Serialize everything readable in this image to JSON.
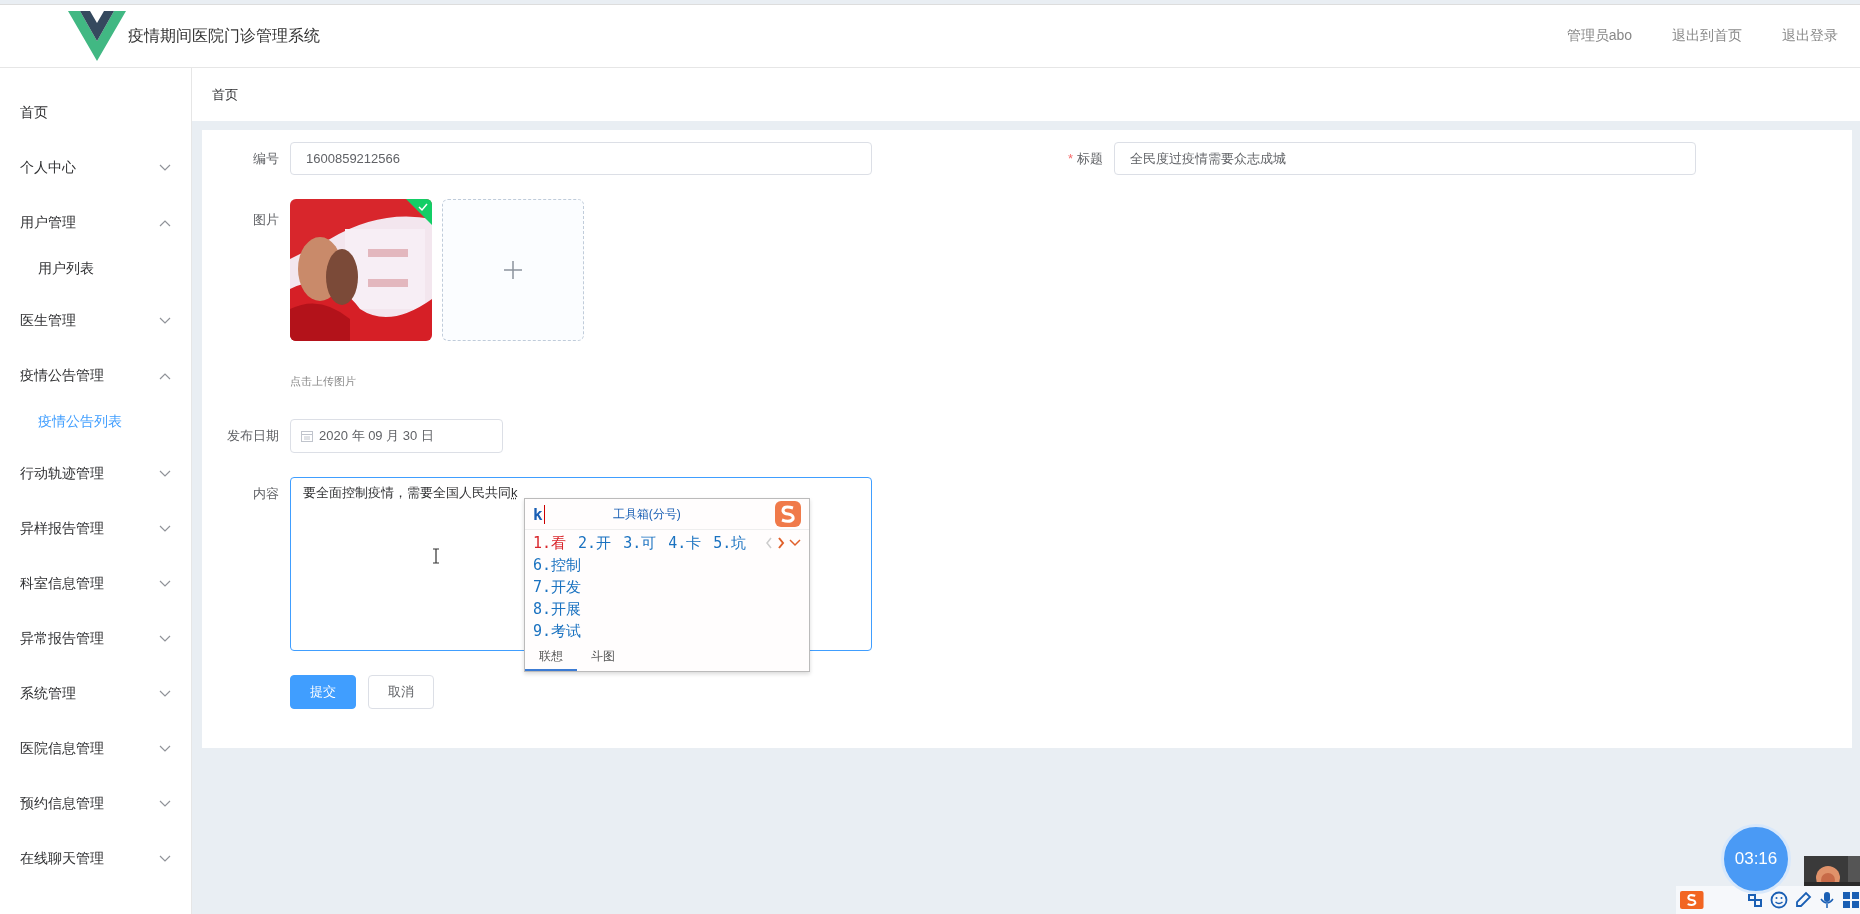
{
  "header": {
    "title": "疫情期间医院门诊管理系统",
    "links": [
      "管理员abo",
      "退出到首页",
      "退出登录"
    ]
  },
  "sidebar": {
    "items": [
      {
        "label": "首页",
        "kind": "link"
      },
      {
        "label": "个人中心",
        "kind": "submenu",
        "expanded": false
      },
      {
        "label": "用户管理",
        "kind": "submenu",
        "expanded": true,
        "children": [
          {
            "label": "用户列表",
            "selected": false
          }
        ]
      },
      {
        "label": "医生管理",
        "kind": "submenu",
        "expanded": false
      },
      {
        "label": "疫情公告管理",
        "kind": "submenu",
        "expanded": true,
        "children": [
          {
            "label": "疫情公告列表",
            "selected": true
          }
        ]
      },
      {
        "label": "行动轨迹管理",
        "kind": "submenu",
        "expanded": false
      },
      {
        "label": "异样报告管理",
        "kind": "submenu",
        "expanded": false
      },
      {
        "label": "科室信息管理",
        "kind": "submenu",
        "expanded": false
      },
      {
        "label": "异常报告管理",
        "kind": "submenu",
        "expanded": false
      },
      {
        "label": "系统管理",
        "kind": "submenu",
        "expanded": false
      },
      {
        "label": "医院信息管理",
        "kind": "submenu",
        "expanded": false
      },
      {
        "label": "预约信息管理",
        "kind": "submenu",
        "expanded": false
      },
      {
        "label": "在线聊天管理",
        "kind": "submenu",
        "expanded": false
      }
    ]
  },
  "breadcrumb": "首页",
  "form": {
    "number": {
      "label": "编号",
      "value": "1600859212566"
    },
    "title": {
      "label": "标题",
      "required_mark": "*",
      "value": "全民度过疫情需要众志成城"
    },
    "image": {
      "label": "图片",
      "uploaded": true,
      "hint": "点击上传图片"
    },
    "date": {
      "label": "发布日期",
      "value": "2020 年 09 月 30 日"
    },
    "content": {
      "label": "内容",
      "value": "要全面控制疫情，需要全国人民共同",
      "composition": "k"
    },
    "buttons": [
      {
        "label": "提交",
        "kind": "primary"
      },
      {
        "label": "取消",
        "kind": "default"
      }
    ]
  },
  "ime": {
    "input": "k",
    "toolbox": "工具箱(分号)",
    "candidates": [
      {
        "label": "1.看",
        "selected": true
      },
      {
        "label": "2.开",
        "selected": false
      },
      {
        "label": "3.可",
        "selected": false
      },
      {
        "label": "4.卡",
        "selected": false
      },
      {
        "label": "5.坑",
        "selected": false
      },
      {
        "label": "6.控制",
        "selected": false
      },
      {
        "label": "7.开发",
        "selected": false
      },
      {
        "label": "8.开展",
        "selected": false
      },
      {
        "label": "9.考试",
        "selected": false
      }
    ],
    "tabs": [
      {
        "label": "联想",
        "selected": true
      },
      {
        "label": "斗图",
        "selected": false
      }
    ]
  },
  "recorder": {
    "time": "03:16"
  }
}
